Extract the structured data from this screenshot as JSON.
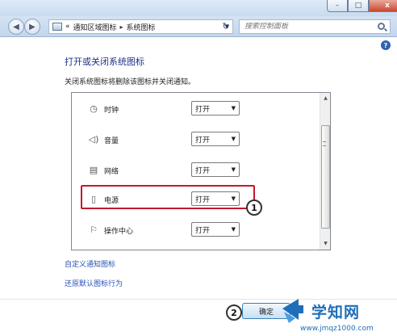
{
  "window": {
    "buttons": [
      "minimize",
      "maximize",
      "close"
    ],
    "close_glyph": "x",
    "max_glyph": "□"
  },
  "nav": {
    "breadcrumb": {
      "prefix": "«",
      "items": [
        "通知区域图标",
        "系统图标"
      ]
    },
    "search_placeholder": "搜索控制面板"
  },
  "page": {
    "heading": "打开或关闭系统图标",
    "description": "关闭系统图标将删除该图标并关闭通知。"
  },
  "system_icons": [
    {
      "label": "时钟",
      "value": "打开",
      "icon": "clock-icon"
    },
    {
      "label": "音量",
      "value": "打开",
      "icon": "volume-icon"
    },
    {
      "label": "网络",
      "value": "打开",
      "icon": "network-icon"
    },
    {
      "label": "电源",
      "value": "打开",
      "icon": "power-icon"
    },
    {
      "label": "操作中心",
      "value": "打开",
      "icon": "flag-icon"
    }
  ],
  "links": {
    "customize": "自定义通知图标",
    "restore": "还原默认图标行为"
  },
  "footer": {
    "ok_label": "确定"
  },
  "annotations": {
    "callout_1": "1",
    "callout_2": "2",
    "highlight_color": "#c21a2e"
  },
  "watermark": {
    "title": "学知网",
    "url": "www.jmqz1000.com"
  },
  "colors": {
    "heading": "#1e3287",
    "link": "#2a53b5",
    "accent": "#1f6fb8"
  }
}
